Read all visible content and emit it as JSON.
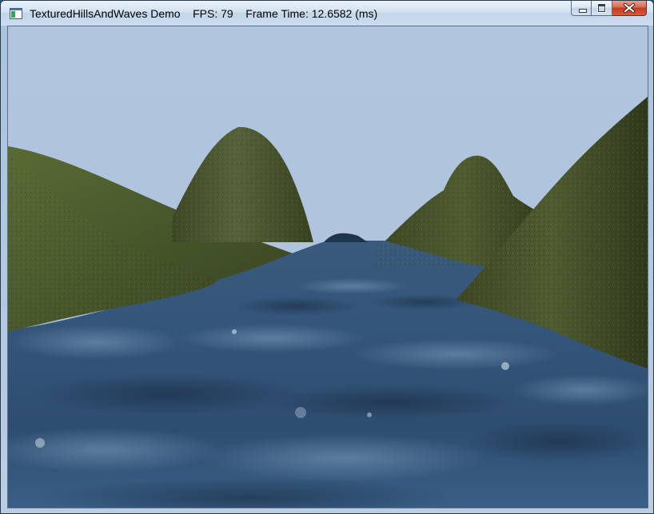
{
  "window": {
    "title": "TexturedHillsAndWaves Demo",
    "fps_label": "FPS: 79",
    "frame_time_label": "Frame Time: 12.6582 (ms)",
    "caption_buttons": {
      "minimize": "minimize",
      "maximize": "maximize",
      "close": "close"
    }
  },
  "scene": {
    "sky_color": "#b0c4de",
    "hill_color": "#4f5a2f",
    "water_color": "#2f4f73"
  },
  "icons": [
    "app-window-icon",
    "minimize-icon",
    "maximize-icon",
    "close-icon"
  ]
}
